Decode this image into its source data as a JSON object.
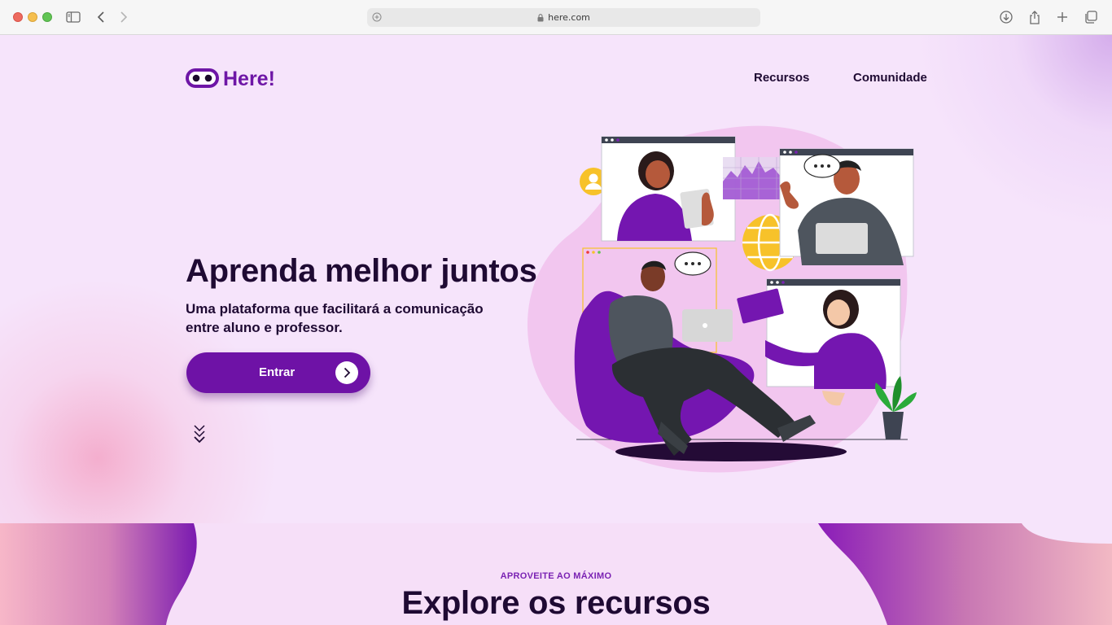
{
  "browser": {
    "url": "here.com",
    "icons": [
      "sidebar-icon",
      "back-icon",
      "forward-icon",
      "lock-icon",
      "download-icon",
      "share-icon",
      "new-tab-icon",
      "tabs-overview-icon"
    ]
  },
  "header": {
    "logo_text": "Here!",
    "nav": [
      "Recursos",
      "Comunidade"
    ]
  },
  "hero": {
    "title": "Aprenda melhor juntos",
    "subtitle_line1": "Uma plataforma que facilitará a comunicação",
    "subtitle_line2": "entre aluno e professor.",
    "cta_label": "Entrar"
  },
  "section": {
    "eyebrow": "APROVEITE AO MÁXIMO",
    "title": "Explore os recursos"
  },
  "colors": {
    "brand": "#6e12a6",
    "text_dark": "#1f0a33",
    "page_bg": "#f6e4fb",
    "accent_yellow": "#f7c22a"
  }
}
